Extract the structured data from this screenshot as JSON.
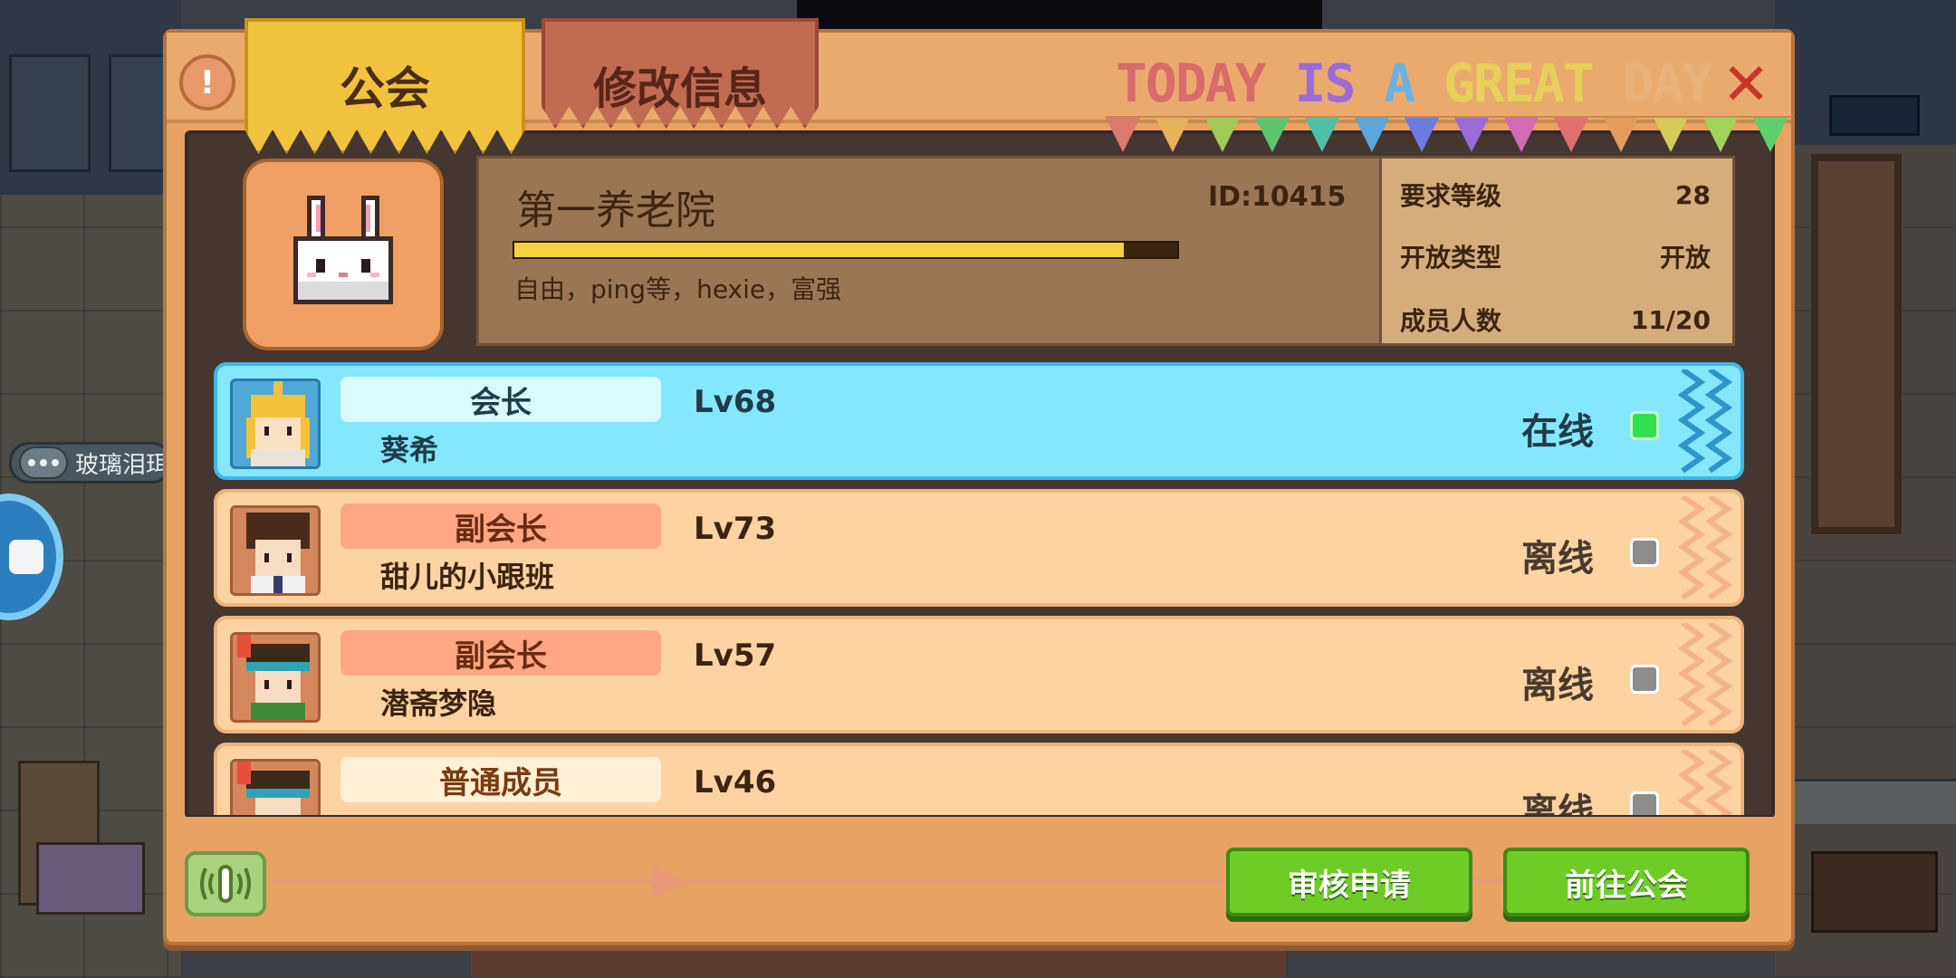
{
  "background": {
    "chat_preview": "玻璃泪珥"
  },
  "tabs": [
    {
      "label": "公会",
      "active": true
    },
    {
      "label": "修改信息",
      "active": false
    }
  ],
  "banner": {
    "words": [
      "TODAY",
      "IS",
      "A",
      "GREAT",
      "DAY"
    ],
    "colors": [
      "#d86b6b",
      "#9b6bd8",
      "#6bb2e4",
      "#e6cf5a",
      "#e8b27a"
    ]
  },
  "icons": {
    "info": "info-icon",
    "close": "close-icon",
    "guild_avatar": "white-rabbit-icon",
    "voice": "voice-icon"
  },
  "guild": {
    "name": "第一养老院",
    "id_text": "ID:10415",
    "progress": 0.92,
    "description": "自由，ping等，hexie，富强",
    "stats": [
      {
        "label": "要求等级",
        "value": "28"
      },
      {
        "label": "开放类型",
        "value": "开放"
      },
      {
        "label": "成员人数",
        "value": "11/20"
      }
    ]
  },
  "members": [
    {
      "role": "会长",
      "name": "葵希",
      "level": "Lv68",
      "status": "在线",
      "online": true,
      "role_type": "leader"
    },
    {
      "role": "副会长",
      "name": "甜儿的小跟班",
      "level": "Lv73",
      "status": "离线",
      "online": false,
      "role_type": "vice"
    },
    {
      "role": "副会长",
      "name": "潜斋梦隐",
      "level": "Lv57",
      "status": "离线",
      "online": false,
      "role_type": "vice"
    },
    {
      "role": "普通成员",
      "name": "",
      "level": "Lv46",
      "status": "离线",
      "online": false,
      "role_type": "member"
    }
  ],
  "footer": {
    "review_label": "审核申请",
    "goto_label": "前往公会"
  },
  "colors": {
    "panel": "#e7a264",
    "online": "#2fe04c",
    "offline": "#8d8d8d",
    "button_green": "#6fcc27",
    "active_row": "#85e7fb"
  }
}
